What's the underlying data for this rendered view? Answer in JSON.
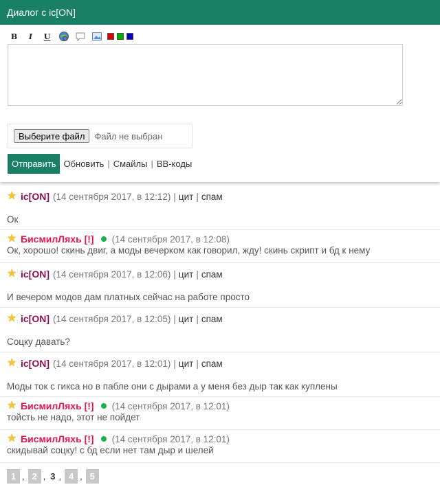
{
  "header": {
    "title": "Диалог с ic[ON]"
  },
  "toolbar": {
    "bold": "B",
    "italic": "I",
    "underline": "U",
    "icons": [
      "link-icon",
      "speech-bubble-icon",
      "image-icon"
    ],
    "colors": [
      "#e00000",
      "#00b000",
      "#0000d0"
    ]
  },
  "composer": {
    "file_button": "Выберите файл",
    "file_status": "Файл не выбран",
    "send_label": "Отправить",
    "refresh_label": "Обновить",
    "smiles_label": "Смайлы",
    "bbcodes_label": "BB-коды",
    "separator": "|"
  },
  "messages": [
    {
      "author": "ic[ON]",
      "online": false,
      "time": "(14 сентября 2017, в 12:12)",
      "cit": "цит",
      "spam": "спам",
      "text": "Ок"
    },
    {
      "author": "БисмилЛяхь [!]",
      "online": true,
      "time": "(14 сентября 2017, в 12:08)",
      "text": "Ок, хорошо! скинь двиг, а моды вечерком как говорил, жду! скинь скрипт и бд к нему"
    },
    {
      "author": "ic[ON]",
      "online": false,
      "time": "(14 сентября 2017, в 12:06)",
      "cit": "цит",
      "spam": "спам",
      "text": "И вечером модов дам платных сейчас на работе просто"
    },
    {
      "author": "ic[ON]",
      "online": false,
      "time": "(14 сентября 2017, в 12:05)",
      "cit": "цит",
      "spam": "спам",
      "text": "Соцку давать?"
    },
    {
      "author": "ic[ON]",
      "online": false,
      "time": "(14 сентября 2017, в 12:01)",
      "cit": "цит",
      "spam": "спам",
      "text": "Моды ток с гикса но в пабле они с дырами а у меня без дыр так как куплены"
    },
    {
      "author": "БисмилЛяхь [!]",
      "online": true,
      "time": "(14 сентября 2017, в 12:01)",
      "text": "тойсть не надо, этот не пойдет"
    },
    {
      "author": "БисмилЛяхь [!]",
      "online": true,
      "time": "(14 сентября 2017, в 12:01)",
      "text": "скидывай соцку! с бд если нет там дыр и шелей"
    }
  ],
  "pagination": {
    "pages": [
      "1",
      "2",
      "3",
      "4",
      "5"
    ],
    "current": "3",
    "separator": ","
  }
}
